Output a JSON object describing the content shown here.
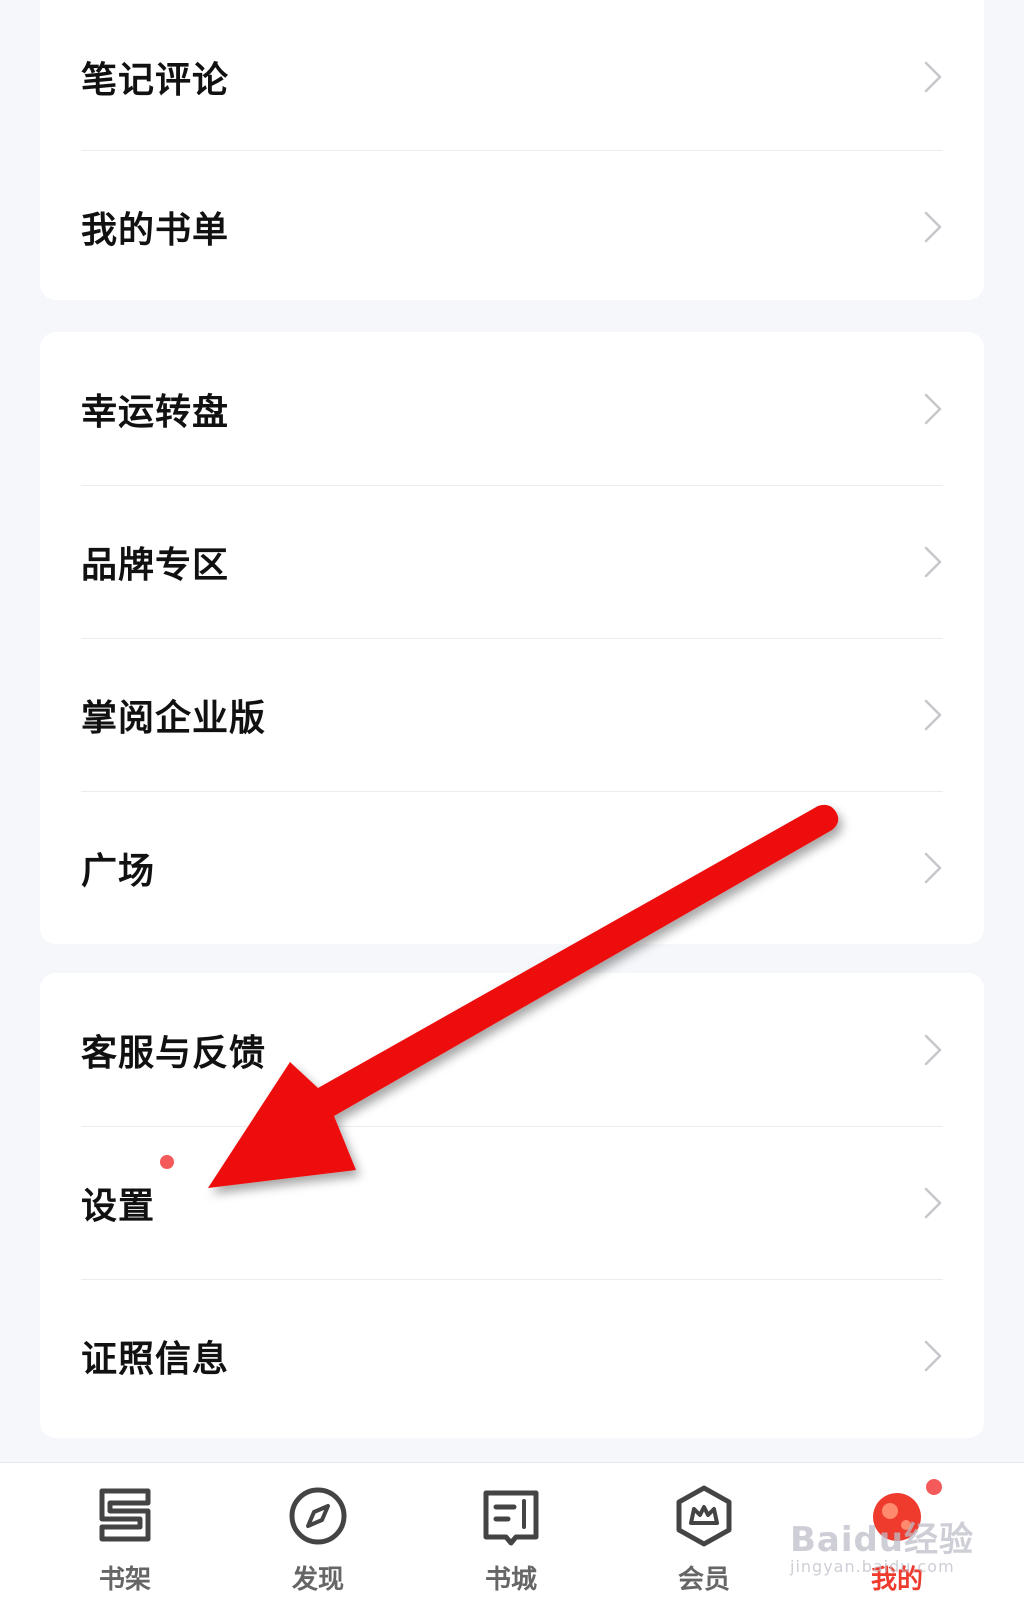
{
  "menu_groups": [
    {
      "items": [
        {
          "label": "笔记评论"
        },
        {
          "label": "我的书单"
        }
      ]
    },
    {
      "items": [
        {
          "label": "幸运转盘"
        },
        {
          "label": "品牌专区"
        },
        {
          "label": "掌阅企业版"
        },
        {
          "label": "广场"
        }
      ]
    },
    {
      "items": [
        {
          "label": "客服与反馈"
        },
        {
          "label": "设置",
          "badge": "red-dot"
        },
        {
          "label": "证照信息"
        }
      ]
    }
  ],
  "tabbar": {
    "tabs": [
      {
        "label": "书架",
        "icon": "bookshelf-icon",
        "active": false
      },
      {
        "label": "发现",
        "icon": "compass-icon",
        "active": false
      },
      {
        "label": "书城",
        "icon": "book-store-icon",
        "active": false
      },
      {
        "label": "会员",
        "icon": "vip-hexagon-icon",
        "active": false
      },
      {
        "label": "我的",
        "icon": "profile-avatar-icon",
        "active": true,
        "badge": "red-dot"
      }
    ]
  },
  "annotation": {
    "arrow_color": "#ee1111",
    "points_to": "设置"
  },
  "watermark": {
    "main": "Baidu经验",
    "sub": "jingyan.baidu.com"
  },
  "colors": {
    "accent": "#ee3b2e",
    "badge": "#f45a5a",
    "background": "#f5f7fb",
    "card": "#ffffff"
  }
}
